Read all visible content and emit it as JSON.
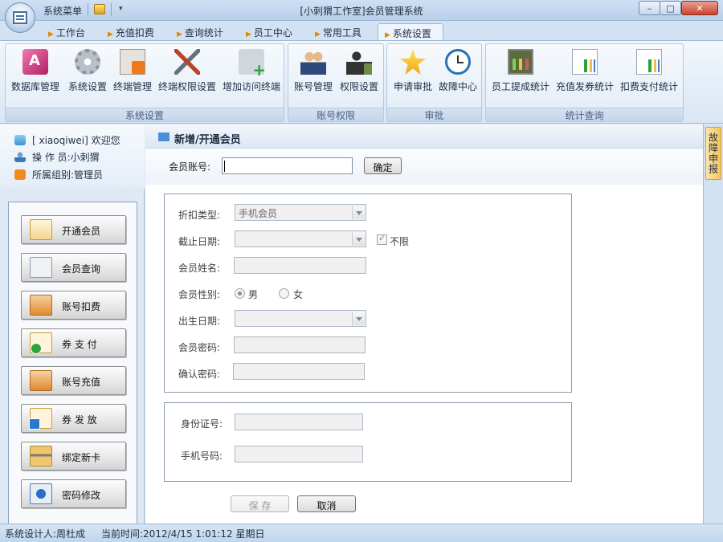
{
  "titlebar": {
    "system_menu": "系统菜单",
    "title": "[小刺猬工作室]会员管理系统",
    "min_symbol": "–",
    "max_symbol": "□",
    "close_symbol": "✕"
  },
  "tabs": [
    {
      "label": "工作台",
      "active": false
    },
    {
      "label": "充值扣费",
      "active": false
    },
    {
      "label": "查询统计",
      "active": false
    },
    {
      "label": "员工中心",
      "active": false
    },
    {
      "label": "常用工具",
      "active": false
    },
    {
      "label": "系统设置",
      "active": true
    }
  ],
  "ribbon": {
    "groups": [
      {
        "label": "系统设置",
        "buttons": [
          {
            "label": "数据库管理",
            "icon": "database-icon"
          },
          {
            "label": "系统设置",
            "icon": "gear-icon"
          },
          {
            "label": "终端管理",
            "icon": "terminal-icon"
          },
          {
            "label": "终端权限设置",
            "icon": "tools-icon"
          },
          {
            "label": "增加访问终端",
            "icon": "add-terminal-icon"
          }
        ]
      },
      {
        "label": "账号权限",
        "buttons": [
          {
            "label": "账号管理",
            "icon": "users-icon"
          },
          {
            "label": "权限设置",
            "icon": "permission-icon"
          }
        ]
      },
      {
        "label": "审批",
        "buttons": [
          {
            "label": "申请审批",
            "icon": "star-icon"
          },
          {
            "label": "故障中心",
            "icon": "clock-icon"
          }
        ]
      },
      {
        "label": "统计查询",
        "buttons": [
          {
            "label": "员工提成统计",
            "icon": "stats-icon"
          },
          {
            "label": "充值发券统计",
            "icon": "report-icon"
          },
          {
            "label": "扣费支付统计",
            "icon": "report-icon"
          }
        ]
      }
    ]
  },
  "user_info": {
    "welcome": "[ xiaoqiwei] 欢迎您",
    "operator": "操 作 员:小刺猬",
    "group": "所属组别:管理员"
  },
  "nav": [
    {
      "label": "开通会员",
      "icon": "open-member-icon"
    },
    {
      "label": "会员查询",
      "icon": "member-query-icon"
    },
    {
      "label": "账号扣费",
      "icon": "account-deduct-icon"
    },
    {
      "label": "券 支 付",
      "icon": "coupon-pay-icon"
    },
    {
      "label": "账号充值",
      "icon": "account-recharge-icon"
    },
    {
      "label": "券 发 放",
      "icon": "coupon-issue-icon"
    },
    {
      "label": "绑定新卡",
      "icon": "bind-card-icon"
    },
    {
      "label": "密码修改",
      "icon": "password-icon"
    }
  ],
  "main": {
    "title": "新增/开通会员",
    "account_label": "会员账号:",
    "account_value": "",
    "confirm_label": "确定",
    "form": {
      "discount_type_label": "折扣类型:",
      "discount_type_value": "手机会员",
      "end_date_label": "截止日期:",
      "end_date_value": "",
      "unlimited_label": "不限",
      "unlimited_checked": true,
      "name_label": "会员姓名:",
      "name_value": "",
      "gender_label": "会员性别:",
      "gender_male": "男",
      "gender_female": "女",
      "gender_selected": "男",
      "birth_label": "出生日期:",
      "birth_value": "",
      "password_label": "会员密码:",
      "password_value": "",
      "confirm_password_label": "确认密码:",
      "confirm_password_value": "",
      "id_label": "身份证号:",
      "id_value": "",
      "phone_label": "手机号码:",
      "phone_value": ""
    },
    "save_label": "保  存",
    "cancel_label": "取消"
  },
  "side_tab": {
    "label": "故障申报"
  },
  "status_bar": {
    "designer": "系统设计人:周杜成",
    "current_time": "当前时间:2012/4/15 1:01:12  星期日"
  }
}
